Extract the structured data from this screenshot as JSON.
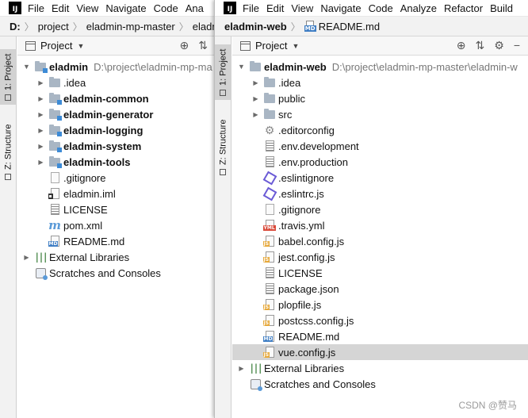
{
  "left": {
    "menu": [
      "File",
      "Edit",
      "View",
      "Navigate",
      "Code",
      "Ana"
    ],
    "breadcrumb": [
      "D:",
      "project",
      "eladmin-mp-master",
      "eladmi"
    ],
    "sidetabs": {
      "project": "1: Project",
      "structure": "Z: Structure"
    },
    "panel_title": "Project",
    "tree": [
      {
        "label": "eladmin",
        "hint": "D:\\project\\eladmin-mp-ma",
        "indent": 0,
        "arrow": "open",
        "icon": "folder-mod",
        "bold": true
      },
      {
        "label": ".idea",
        "indent": 1,
        "arrow": "closed",
        "icon": "folder"
      },
      {
        "label": "eladmin-common",
        "indent": 1,
        "arrow": "closed",
        "icon": "folder-mod",
        "bold": true
      },
      {
        "label": "eladmin-generator",
        "indent": 1,
        "arrow": "closed",
        "icon": "folder-mod",
        "bold": true
      },
      {
        "label": "eladmin-logging",
        "indent": 1,
        "arrow": "closed",
        "icon": "folder-mod",
        "bold": true
      },
      {
        "label": "eladmin-system",
        "indent": 1,
        "arrow": "closed",
        "icon": "folder-mod",
        "bold": true
      },
      {
        "label": "eladmin-tools",
        "indent": 1,
        "arrow": "closed",
        "icon": "folder-mod",
        "bold": true
      },
      {
        "label": ".gitignore",
        "indent": 1,
        "arrow": "none",
        "icon": "gitignore"
      },
      {
        "label": "eladmin.iml",
        "indent": 1,
        "arrow": "none",
        "icon": "iml"
      },
      {
        "label": "LICENSE",
        "indent": 1,
        "arrow": "none",
        "icon": "text"
      },
      {
        "label": "pom.xml",
        "indent": 1,
        "arrow": "none",
        "icon": "maven"
      },
      {
        "label": "README.md",
        "indent": 1,
        "arrow": "none",
        "icon": "md"
      },
      {
        "label": "External Libraries",
        "indent": 0,
        "arrow": "closed",
        "icon": "library"
      },
      {
        "label": "Scratches and Consoles",
        "indent": 0,
        "arrow": "none",
        "icon": "scratch"
      }
    ]
  },
  "right": {
    "menu": [
      "File",
      "Edit",
      "View",
      "Navigate",
      "Code",
      "Analyze",
      "Refactor",
      "Build"
    ],
    "breadcrumb": {
      "project": "eladmin-web",
      "file": "README.md",
      "file_tag": "MD"
    },
    "sidetabs": {
      "project": "1: Project",
      "structure": "Z: Structure"
    },
    "panel_title": "Project",
    "tree": [
      {
        "label": "eladmin-web",
        "hint": "D:\\project\\eladmin-mp-master\\eladmin-w",
        "indent": 0,
        "arrow": "open",
        "icon": "folder",
        "bold": true
      },
      {
        "label": ".idea",
        "indent": 1,
        "arrow": "closed",
        "icon": "folder"
      },
      {
        "label": "public",
        "indent": 1,
        "arrow": "closed",
        "icon": "folder"
      },
      {
        "label": "src",
        "indent": 1,
        "arrow": "closed",
        "icon": "folder"
      },
      {
        "label": ".editorconfig",
        "indent": 1,
        "arrow": "none",
        "icon": "gear"
      },
      {
        "label": ".env.development",
        "indent": 1,
        "arrow": "none",
        "icon": "text"
      },
      {
        "label": ".env.production",
        "indent": 1,
        "arrow": "none",
        "icon": "text"
      },
      {
        "label": ".eslintignore",
        "indent": 1,
        "arrow": "none",
        "icon": "eslint"
      },
      {
        "label": ".eslintrc.js",
        "indent": 1,
        "arrow": "none",
        "icon": "eslint"
      },
      {
        "label": ".gitignore",
        "indent": 1,
        "arrow": "none",
        "icon": "gitignore"
      },
      {
        "label": ".travis.yml",
        "indent": 1,
        "arrow": "none",
        "icon": "yml"
      },
      {
        "label": "babel.config.js",
        "indent": 1,
        "arrow": "none",
        "icon": "js"
      },
      {
        "label": "jest.config.js",
        "indent": 1,
        "arrow": "none",
        "icon": "js"
      },
      {
        "label": "LICENSE",
        "indent": 1,
        "arrow": "none",
        "icon": "text"
      },
      {
        "label": "package.json",
        "indent": 1,
        "arrow": "none",
        "icon": "json"
      },
      {
        "label": "plopfile.js",
        "indent": 1,
        "arrow": "none",
        "icon": "js"
      },
      {
        "label": "postcss.config.js",
        "indent": 1,
        "arrow": "none",
        "icon": "js"
      },
      {
        "label": "README.md",
        "indent": 1,
        "arrow": "none",
        "icon": "md"
      },
      {
        "label": "vue.config.js",
        "indent": 1,
        "arrow": "none",
        "icon": "js",
        "selected": true
      },
      {
        "label": "External Libraries",
        "indent": 0,
        "arrow": "closed",
        "icon": "library"
      },
      {
        "label": "Scratches and Consoles",
        "indent": 0,
        "arrow": "none",
        "icon": "scratch"
      }
    ]
  },
  "watermark": "CSDN @赞马",
  "colors": {
    "selected_row": "#d5d5d5",
    "module_badge": "#3d8bd6",
    "js_tag": "#e6a83a",
    "md_tag": "#3f7ec4"
  }
}
